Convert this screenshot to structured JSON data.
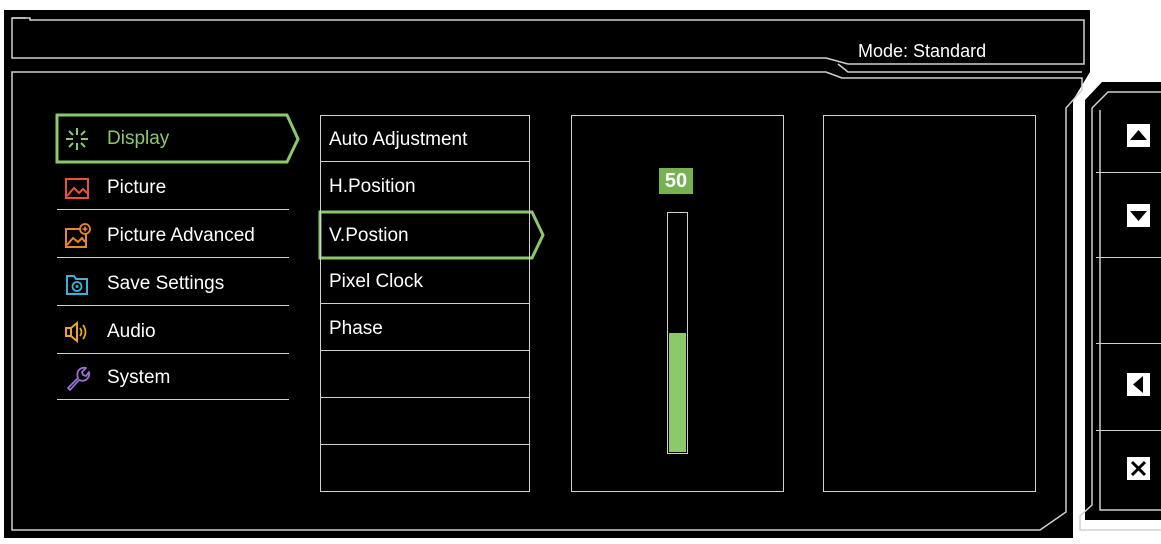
{
  "header": {
    "mode_text": "Mode: Standard"
  },
  "main_menu": {
    "items": [
      {
        "label": "Display",
        "icon": "display-icon",
        "selected": true
      },
      {
        "label": "Picture",
        "icon": "picture-icon"
      },
      {
        "label": "Picture Advanced",
        "icon": "picture-advanced-icon"
      },
      {
        "label": "Save Settings",
        "icon": "save-settings-icon"
      },
      {
        "label": "Audio",
        "icon": "audio-icon"
      },
      {
        "label": "System",
        "icon": "system-icon"
      }
    ]
  },
  "sub_menu": {
    "items": [
      {
        "label": "Auto Adjustment"
      },
      {
        "label": "H.Position"
      },
      {
        "label": "V.Postion",
        "selected": true
      },
      {
        "label": "Pixel Clock"
      },
      {
        "label": "Phase"
      },
      {
        "label": ""
      },
      {
        "label": ""
      },
      {
        "label": ""
      }
    ]
  },
  "value": {
    "label": "50",
    "level_fraction": 0.5
  },
  "side_buttons": [
    {
      "icon": "triangle-up-icon"
    },
    {
      "icon": "triangle-down-icon"
    },
    {
      "icon": "triangle-left-icon"
    },
    {
      "icon": "close-icon"
    }
  ],
  "colors": {
    "accent": "#8cc96b",
    "background": "#000000",
    "line": "#d0d0d0"
  }
}
